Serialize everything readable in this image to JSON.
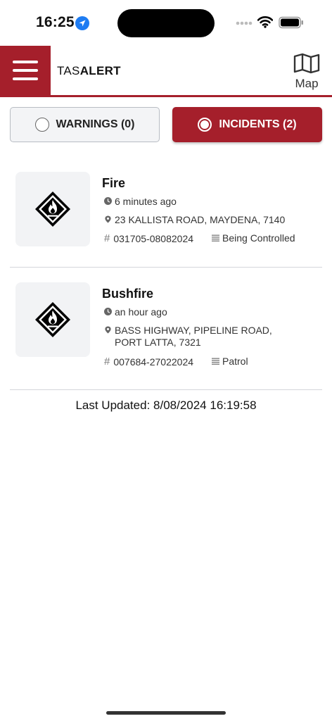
{
  "status_bar": {
    "time": "16:25"
  },
  "header": {
    "brand_light": "TAS",
    "brand_bold": "ALERT",
    "map_label": "Map"
  },
  "tabs": {
    "warnings_label": "WARNINGS (0)",
    "incidents_label": "INCIDENTS (2)",
    "selected": "incidents"
  },
  "incidents": [
    {
      "title": "Fire",
      "time_ago": "6 minutes ago",
      "location": "23 KALLISTA ROAD, MAYDENA, 7140",
      "code": "031705-08082024",
      "status": "Being Controlled"
    },
    {
      "title": "Bushfire",
      "time_ago": "an hour ago",
      "location": "BASS HIGHWAY, PIPELINE ROAD, PORT LATTA, 7321",
      "code": "007684-27022024",
      "status": "Patrol"
    }
  ],
  "footer": {
    "last_updated": "Last Updated: 8/08/2024 16:19:58"
  },
  "colors": {
    "brand_red": "#a51f2b",
    "thumb_bg": "#f2f3f5"
  },
  "icons": [
    "location-arrow-icon",
    "signal-icon",
    "wifi-icon",
    "battery-icon",
    "menu-icon",
    "map-icon",
    "fire-hazard-icon",
    "clock-icon",
    "map-pin-icon",
    "hash-icon",
    "list-icon"
  ]
}
